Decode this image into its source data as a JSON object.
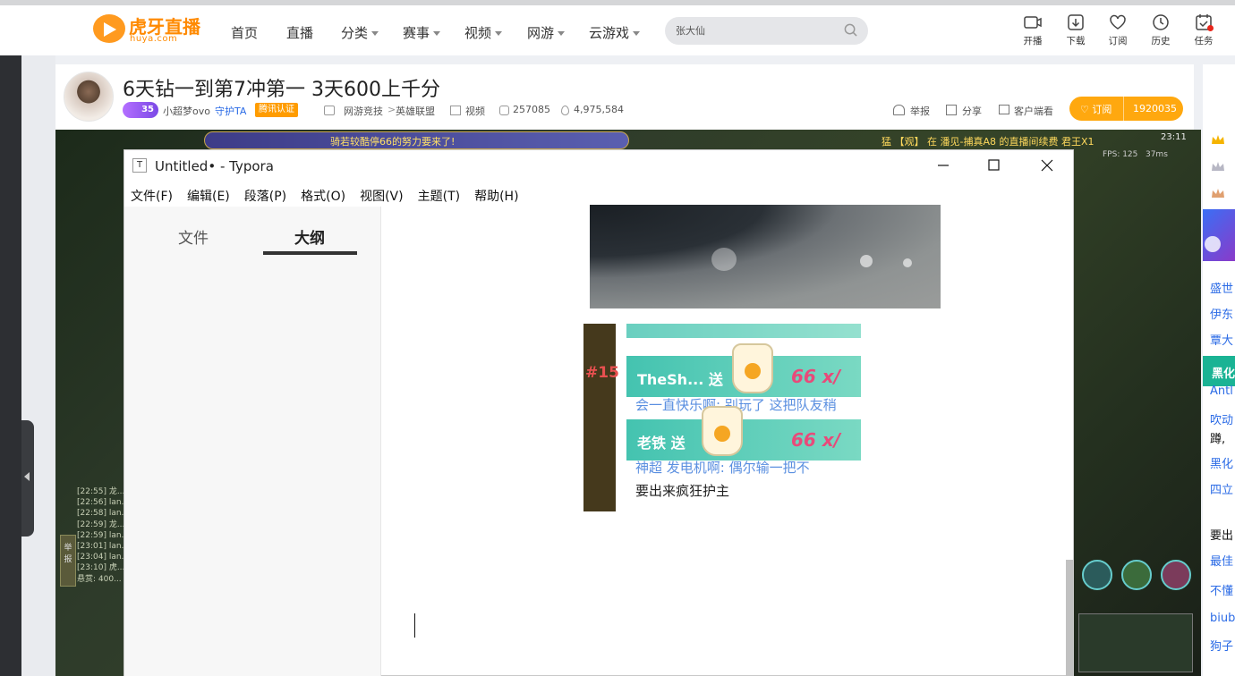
{
  "site": {
    "logo": {
      "name": "虎牙直播",
      "sub": "huya.com"
    },
    "nav": [
      {
        "label": "首页"
      },
      {
        "label": "直播"
      },
      {
        "label": "分类"
      },
      {
        "label": "赛事"
      },
      {
        "label": "视频"
      },
      {
        "label": "网游"
      },
      {
        "label": "云游戏"
      }
    ],
    "search": {
      "value": "张大仙"
    },
    "actions": [
      {
        "label": "开播",
        "icon": "broadcast-icon"
      },
      {
        "label": "下载",
        "icon": "download-icon"
      },
      {
        "label": "订阅",
        "icon": "heart-icon"
      },
      {
        "label": "历史",
        "icon": "clock-icon"
      },
      {
        "label": "任务",
        "icon": "task-icon"
      }
    ]
  },
  "room": {
    "title": "6天钻一到第7冲第一 3天600上千分",
    "level": "35",
    "streamer": "小超梦ovo",
    "guard": "守护TA",
    "cert": "腾讯认证",
    "category": "网游竞技",
    "game": "英雄联盟",
    "video_label": "视频",
    "room_id": "257085",
    "popularity": "4,975,584",
    "report": "举报",
    "share": "分享",
    "client": "客户端看",
    "subscribe": "订阅",
    "subscribers": "1920035"
  },
  "video": {
    "banner": "骑若较酷停66的努力要来了!",
    "right_notice": "猛 【观】 在 潘见-捕真A8 的直播间续费 君王X1",
    "time": "23:11",
    "fps": "FPS: 125",
    "ping": "37ms",
    "chat_lines": [
      "[22:55] 龙...",
      "[22:56] lan...",
      "[22:58] lan...",
      "[22:59] 龙...",
      "[22:59] lan...",
      "[23:01] lan...",
      "[23:04] lan...",
      "[23:10] 虎...",
      "悬赏: 400..."
    ],
    "report_btn": "举报"
  },
  "sidebar": {
    "lines": [
      "盛世",
      "伊东",
      "覃大",
      "黑化",
      "Antl",
      "吹动",
      "蹲,",
      "黑化",
      "四立",
      "要出",
      "最佳",
      "不懂",
      "biub",
      "狗子"
    ]
  },
  "typora": {
    "title": "Untitled• - Typora",
    "app_icon": "T",
    "menu": [
      "文件(F)",
      "编辑(E)",
      "段落(P)",
      "格式(O)",
      "视图(V)",
      "主题(T)",
      "帮助(H)"
    ],
    "tabs": {
      "files": "文件",
      "outline": "大纲"
    },
    "image2": {
      "edge_text": "#15",
      "gift1_name": "TheSh... 送",
      "gift1_count": "66 x/",
      "chat1": "会一直快乐啊: 别玩了 这把队友稍",
      "gift2_name": "老铁 送",
      "gift2_count": "66 x/",
      "chat2": "神超 发电机啊: 偶尔输一把不",
      "chat3": "要出来疯狂护主"
    }
  },
  "colors": {
    "brand": "#ff8a00",
    "subscribe": "#ffa80f",
    "link": "#2b6be6",
    "accent_green": "#1ab394"
  }
}
